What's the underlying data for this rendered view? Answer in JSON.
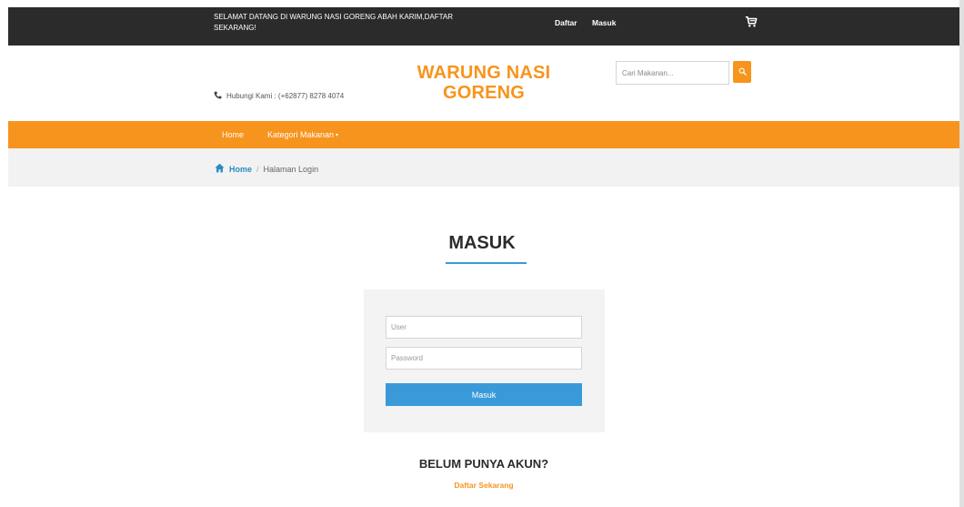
{
  "topbar": {
    "welcome": "SELAMAT DATANG DI WARUNG NASI GORENG ABAH KARIM,DAFTAR SEKARANG!",
    "daftar_label": "Daftar",
    "masuk_label": "Masuk",
    "cart_icon": "cart-icon"
  },
  "header": {
    "phone_icon": "phone-icon",
    "phone_text": "Hubungi Kami : (+62877) 8278 4074",
    "brand": "WARUNG NASI GORENG",
    "search_placeholder": "Cari Makanan...",
    "search_icon": "search-icon"
  },
  "nav": {
    "home": "Home",
    "kategori": "Kategori Makanan",
    "caret": "▾"
  },
  "breadcrumb": {
    "home_icon": "home-icon",
    "home": "Home",
    "separator": "/",
    "current": "Halaman Login"
  },
  "login": {
    "title": "MASUK",
    "user_placeholder": "User",
    "password_placeholder": "Password",
    "submit_label": "Masuk",
    "no_account": "BELUM PUNYA AKUN?",
    "register_link": "Daftar Sekarang"
  },
  "colors": {
    "accent_orange": "#f7941d",
    "accent_blue": "#3a9ad9",
    "topbar_bg": "#2b2b2b"
  }
}
